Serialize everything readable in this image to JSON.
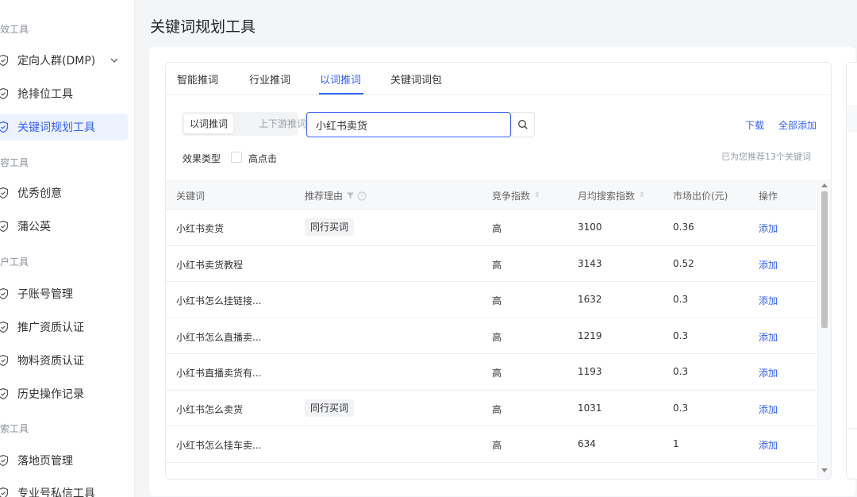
{
  "sidebar": {
    "sections": [
      "效工具",
      "容工具",
      "户工具",
      "索工具"
    ],
    "items": [
      {
        "label": "定向人群(DMP)",
        "icon": "shield-check-icon",
        "active": false,
        "has_chevron": true
      },
      {
        "label": "抢排位工具",
        "icon": "shield-check-icon",
        "active": false
      },
      {
        "label": "关键词规划工具",
        "icon": "shield-check-icon",
        "active": true
      },
      {
        "label": "优秀创意",
        "icon": "shield-check-icon",
        "active": false
      },
      {
        "label": "蒲公英",
        "icon": "shield-check-icon",
        "active": false
      },
      {
        "label": "子账号管理",
        "icon": "shield-check-icon",
        "active": false
      },
      {
        "label": "推广资质认证",
        "icon": "shield-check-icon",
        "active": false
      },
      {
        "label": "物料资质认证",
        "icon": "shield-check-icon",
        "active": false
      },
      {
        "label": "历史操作记录",
        "icon": "shield-check-icon",
        "active": false
      },
      {
        "label": "落地页管理",
        "icon": "shield-check-icon",
        "active": false
      },
      {
        "label": "专业号私信工具",
        "icon": "shield-check-icon",
        "active": false
      }
    ]
  },
  "page": {
    "title": "关键词规划工具"
  },
  "tabs": [
    "智能推词",
    "行业推词",
    "以词推词",
    "关键词词包"
  ],
  "active_tab": 2,
  "segment": {
    "options": [
      "以词推词",
      "上下游推词"
    ],
    "selected": 0
  },
  "search": {
    "value": "小红书卖货",
    "icon": "search-icon"
  },
  "actions": {
    "download": "下载",
    "add_all": "全部添加"
  },
  "filter": {
    "label": "效果类型",
    "option": "高点击",
    "checked": false
  },
  "recommend_note": "已为您推荐13个关键词",
  "table": {
    "columns": [
      "关键词",
      "推荐理由",
      "竞争指数",
      "月均搜索指数",
      "市场出价(元)",
      "操作"
    ],
    "rows": [
      {
        "keyword": "小红书卖货",
        "reason": "同行买词",
        "competition": "高",
        "monthly_search": "3100",
        "bid": "0.36",
        "action": "添加"
      },
      {
        "keyword": "小红书卖货教程",
        "reason": "",
        "competition": "高",
        "monthly_search": "3143",
        "bid": "0.52",
        "action": "添加"
      },
      {
        "keyword": "小红书怎么挂链接...",
        "reason": "",
        "competition": "高",
        "monthly_search": "1632",
        "bid": "0.3",
        "action": "添加"
      },
      {
        "keyword": "小红书怎么直播卖...",
        "reason": "",
        "competition": "高",
        "monthly_search": "1219",
        "bid": "0.3",
        "action": "添加"
      },
      {
        "keyword": "小红书直播卖货有...",
        "reason": "",
        "competition": "高",
        "monthly_search": "1193",
        "bid": "0.3",
        "action": "添加"
      },
      {
        "keyword": "小红书怎么卖货",
        "reason": "同行买词",
        "competition": "高",
        "monthly_search": "1031",
        "bid": "0.3",
        "action": "添加"
      },
      {
        "keyword": "小红书怎么挂车卖...",
        "reason": "",
        "competition": "高",
        "monthly_search": "634",
        "bid": "1",
        "action": "添加"
      }
    ]
  },
  "colors": {
    "accent": "#3561f5",
    "active_bg": "#edf2ff",
    "header_bg": "#f7f8fa"
  }
}
